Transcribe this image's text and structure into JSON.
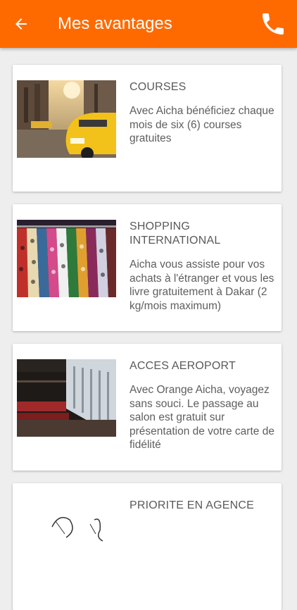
{
  "appbar": {
    "title": "Mes avantages",
    "back_icon": "arrow-left-icon",
    "call_icon": "phone-icon",
    "color": "#ff6a00"
  },
  "cards": [
    {
      "title": "COURSES",
      "description": "Avec Aicha bénéficiez chaque mois de six (6) courses gratuites",
      "image": "taxi-street-photo"
    },
    {
      "title": "SHOPPING INTERNATIONAL",
      "description": "Aicha vous assiste pour vos achats à l'étranger et vous les livre gratuitement à Dakar (2 kg/mois maximum)",
      "image": "clothing-rack-photo"
    },
    {
      "title": "ACCES AEROPORT",
      "description": "Avec Orange Aicha, voyagez sans souci. Le passage au salon est gratuit sur présentation de votre carte de fidélité",
      "image": "airport-lounge-photo"
    },
    {
      "title": "PRIORITE EN AGENCE",
      "description": "",
      "image": "sketch-photo"
    }
  ]
}
